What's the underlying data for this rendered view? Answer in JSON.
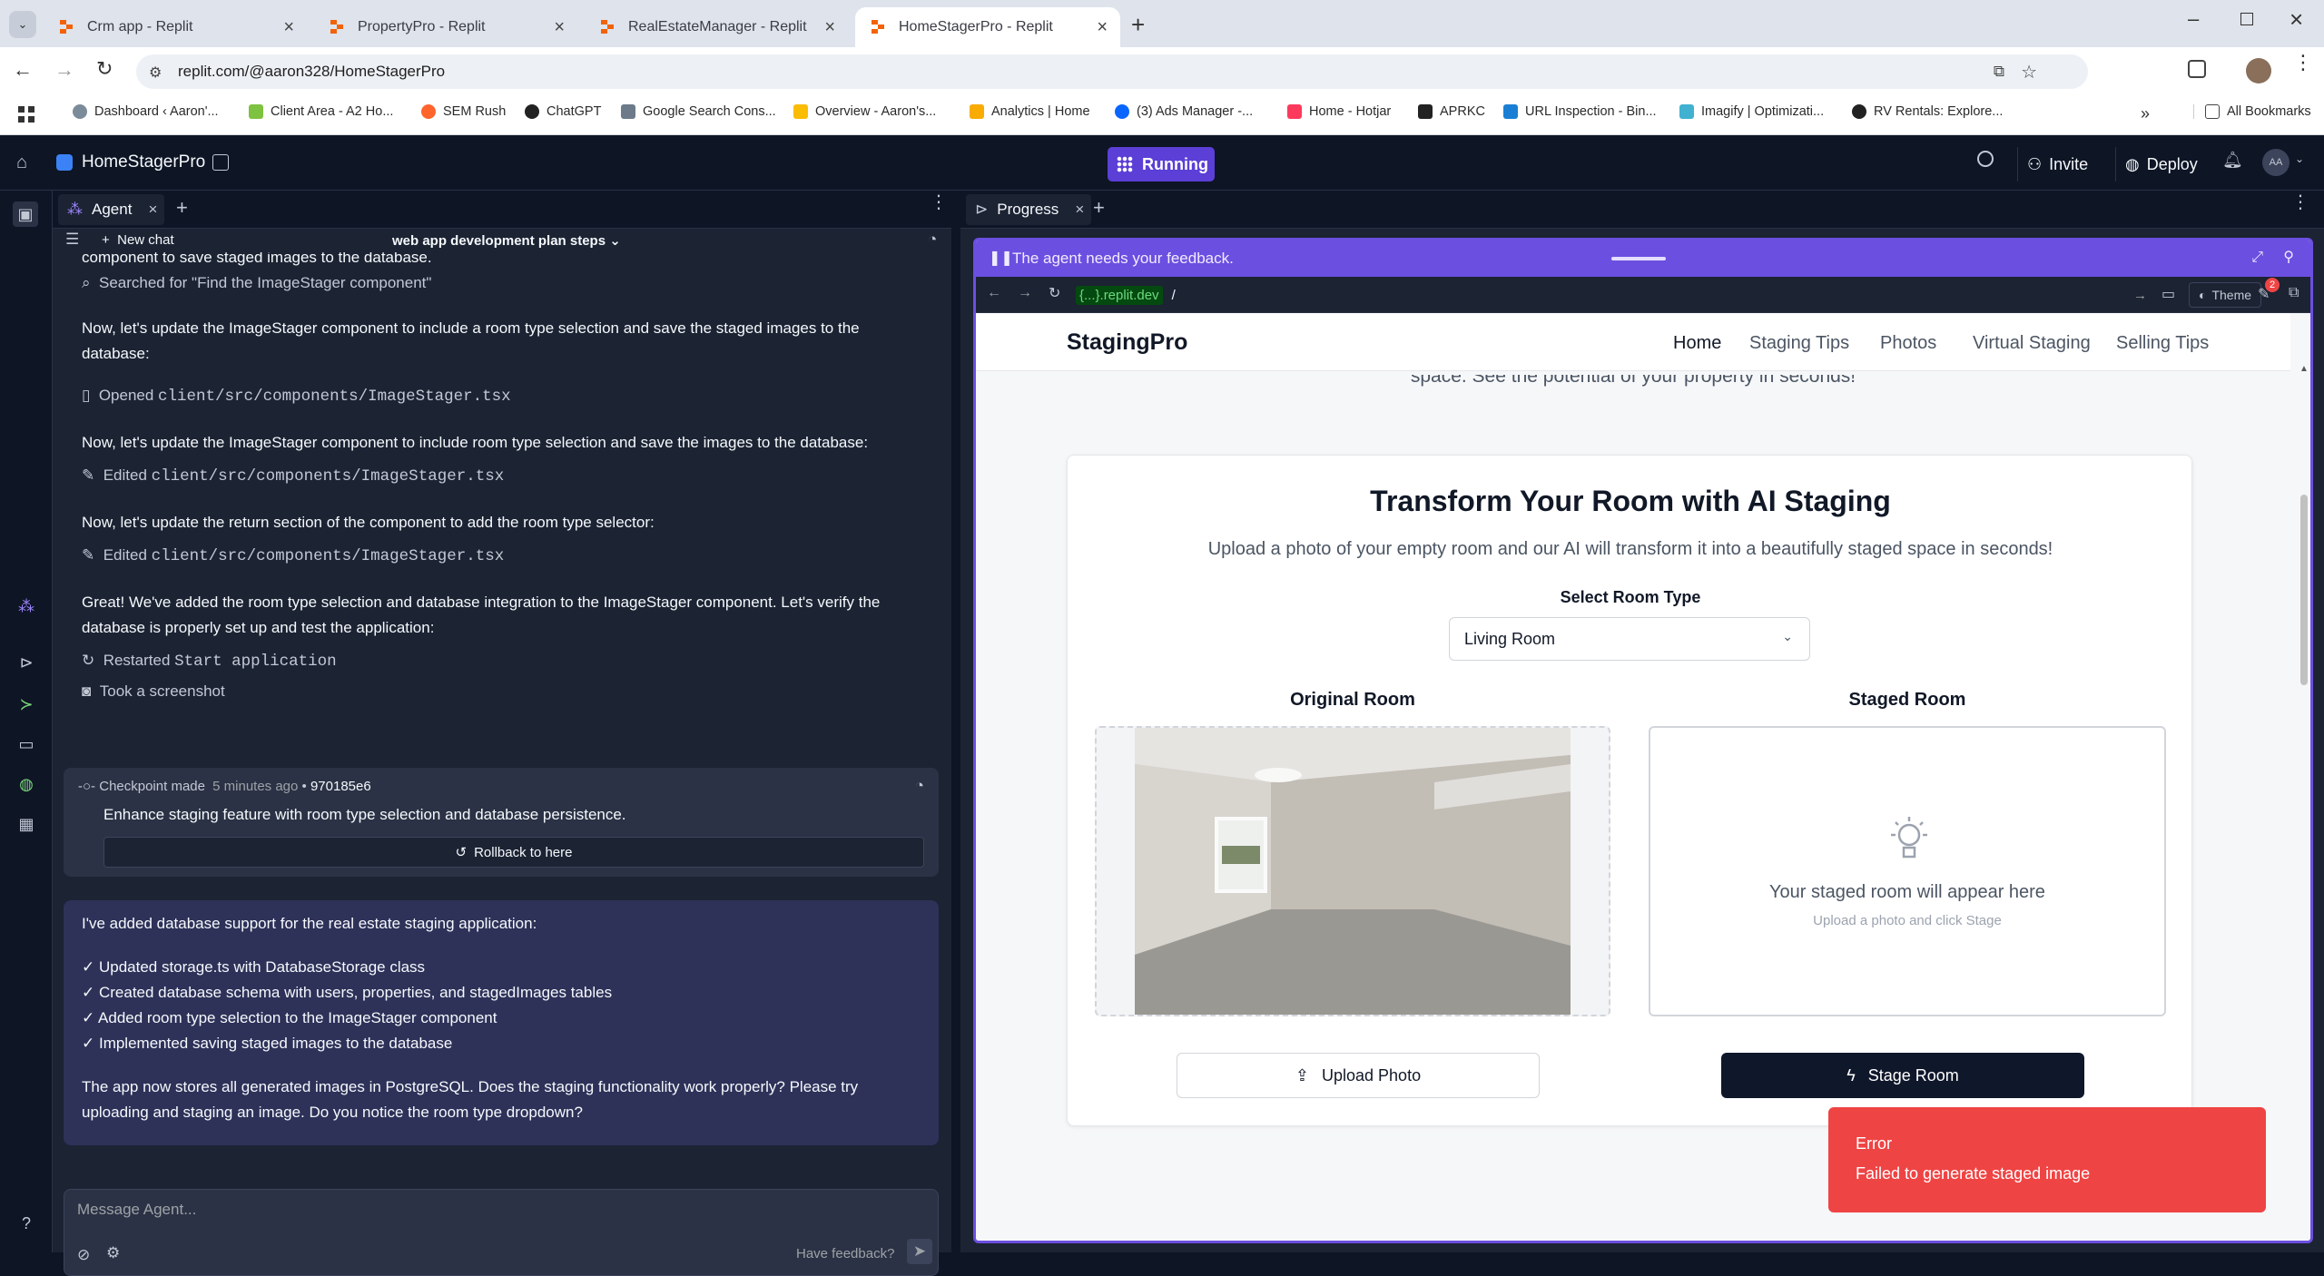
{
  "browser": {
    "tabs": [
      {
        "title": "Crm app - Replit"
      },
      {
        "title": "PropertyPro - Replit"
      },
      {
        "title": "RealEstateManager - Replit"
      },
      {
        "title": "HomeStagerPro - Replit"
      }
    ],
    "url": "replit.com/@aaron328/HomeStagerPro",
    "bookmarks": [
      "Dashboard ‹ Aaron'...",
      "Client Area - A2 Ho...",
      "SEM Rush",
      "ChatGPT",
      "Google Search Cons...",
      "Overview - Aaron's...",
      "Analytics | Home",
      "(3) Ads Manager -...",
      "Home - Hotjar",
      "APRKC",
      "URL Inspection - Bin...",
      "Imagify | Optimizati...",
      "RV Rentals: Explore..."
    ],
    "all_bookmarks": "All Bookmarks"
  },
  "replit": {
    "project_name": "HomeStagerPro",
    "run_status": "Running",
    "invite": "Invite",
    "deploy": "Deploy",
    "avatar_initials": "AA"
  },
  "agent": {
    "tab_label": "Agent",
    "new_chat": "New chat",
    "chat_title": "web app development plan steps",
    "cut_line": "component to save staged images to the database.",
    "searched": "Searched for \"Find the ImageStager component\"",
    "step1": "Now, let's update the ImageStager component to include a room type selection and save the staged images to the",
    "step1b": "database:",
    "opened_label": "Opened",
    "opened_file": "client/src/components/ImageStager.tsx",
    "step2": "Now, let's update the ImageStager component to include room type selection and save the images to the database:",
    "edited_label": "Edited",
    "edited_file1": "client/src/components/ImageStager.tsx",
    "step3": "Now, let's update the return section of the component to add the room type selector:",
    "edited_file2": "client/src/components/ImageStager.tsx",
    "great1": "Great! We've added the room type selection and database integration to the ImageStager component. Let's verify the",
    "great2": "database is properly set up and test the application:",
    "restarted_label": "Restarted",
    "restarted_value": "Start application",
    "screenshot": "Took a screenshot",
    "checkpoint": {
      "label": "Checkpoint made",
      "time": "5 minutes ago",
      "hash": "970185e6",
      "message": "Enhance staging feature with room type selection and database persistence.",
      "rollback": "Rollback to here"
    },
    "reply": {
      "intro": "I've added database support for the real estate staging application:",
      "items": [
        "✓ Updated storage.ts with DatabaseStorage class",
        "✓ Created database schema with users, properties, and stagedImages tables",
        "✓ Added room type selection to the ImageStager component",
        "✓ Implemented saving staged images to the database"
      ],
      "outro1": "The app now stores all generated images in PostgreSQL. Does the staging functionality work properly? Please try",
      "outro2": "uploading and staging an image. Do you notice the room type dropdown?"
    },
    "input_placeholder": "Message Agent...",
    "feedback": "Have feedback?"
  },
  "progress": {
    "tab_label": "Progress",
    "banner": "The agent needs your feedback.",
    "web_url_prefix": "{...}.replit.dev",
    "web_path": "/",
    "theme": "Theme",
    "badge": "2"
  },
  "site": {
    "brand": "StagingPro",
    "nav": [
      "Home",
      "Staging Tips",
      "Photos",
      "Virtual Staging",
      "Selling Tips"
    ],
    "hero_cut": "space. See the potential of your property in seconds!",
    "card_title": "Transform Your Room with AI Staging",
    "card_subtitle": "Upload a photo of your empty room and our AI will transform it into a beautifully staged space in seconds!",
    "select_label": "Select Room Type",
    "select_value": "Living Room",
    "original_label": "Original Room",
    "staged_label": "Staged Room",
    "placeholder_title": "Your staged room will appear here",
    "placeholder_sub": "Upload a photo and click Stage",
    "upload_btn": "Upload Photo",
    "stage_btn": "Stage Room"
  },
  "toast": {
    "title": "Error",
    "message": "Failed to generate staged image"
  },
  "colors": {
    "replit_bg": "#0e1525",
    "panel": "#1c2333",
    "accent": "#6b4fe0",
    "error": "#ef4444",
    "dark_button": "#0f172a"
  }
}
